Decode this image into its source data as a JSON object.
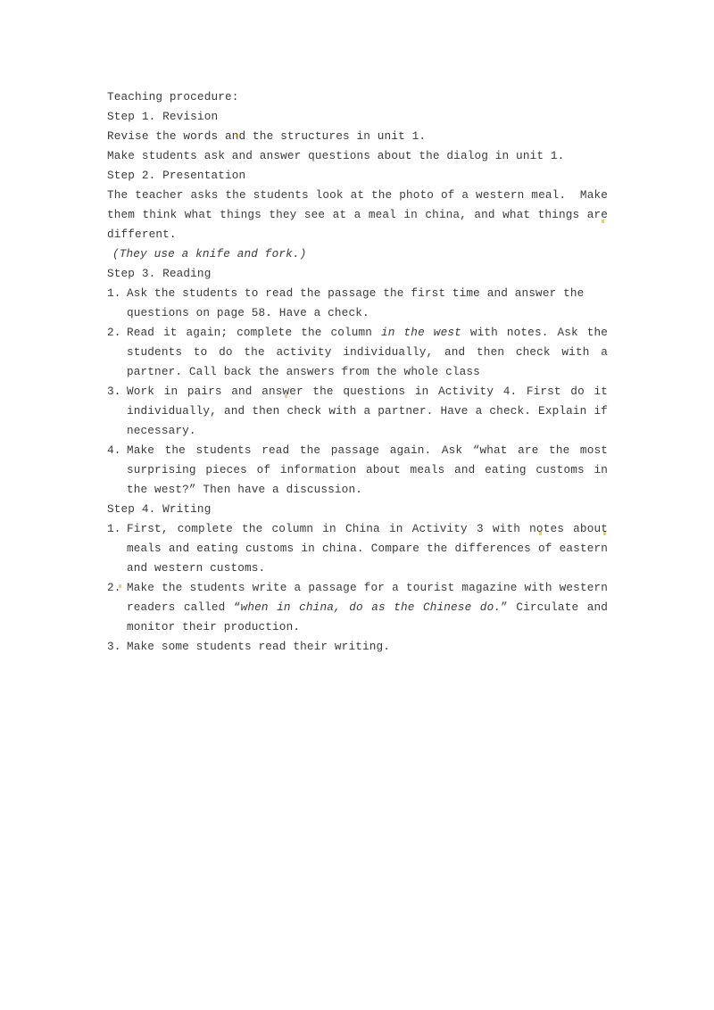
{
  "document": {
    "background_color": "#ffffff",
    "text_color": "#3a3a3a",
    "heading": "Teaching procedure:",
    "steps": [
      {
        "title": "Step 1. Revision",
        "paragraphs": [
          "Revise the words and the structures in unit 1.",
          "Make students ask and answer questions about the dialog in unit 1."
        ]
      },
      {
        "title": "Step 2. Presentation",
        "paragraphs": [
          "The teacher asks the students look at the photo of a western meal.  Make them think what things they see at a meal in china, and what things are different."
        ],
        "italic_note": "(They use a knife and fork.)"
      },
      {
        "title": "Step 3. Reading",
        "items": [
          {
            "marker": "1.",
            "pre": "Ask the students to read the passage the first time and answer the questions on page 58. Have a check.",
            "italic": "",
            "post": ""
          },
          {
            "marker": "2.",
            "pre": "Read it again; complete the column ",
            "italic": "in the west",
            "post": " with notes. Ask the students to do the activity individually, and then check with a partner. Call back the answers from the whole class"
          },
          {
            "marker": "3.",
            "pre": "Work in pairs and answer the questions in Activity 4. First do it individually, and then check with a partner. Have a check. Explain if necessary.",
            "italic": "",
            "post": ""
          },
          {
            "marker": "4.",
            "pre": "Make the students read the passage again. Ask  “what are the most surprising pieces of information about meals and eating customs in the west?”  Then have a discussion.",
            "italic": "",
            "post": ""
          }
        ]
      },
      {
        "title": "Step 4. Writing",
        "items": [
          {
            "marker": "1.",
            "pre": "First, complete the column in China in Activity 3 with notes about meals and eating customs in china. Compare the differences of eastern and western customs.",
            "italic": "",
            "post": ""
          },
          {
            "marker": "2.",
            "pre": "Make the students write a passage for a tourist magazine with western readers called  “",
            "italic": "when in china, do as the Chinese do.",
            "post": "” Circulate and monitor their production."
          },
          {
            "marker": "3.",
            "pre": "Make some students read their writing.",
            "italic": "",
            "post": ""
          }
        ]
      }
    ]
  }
}
